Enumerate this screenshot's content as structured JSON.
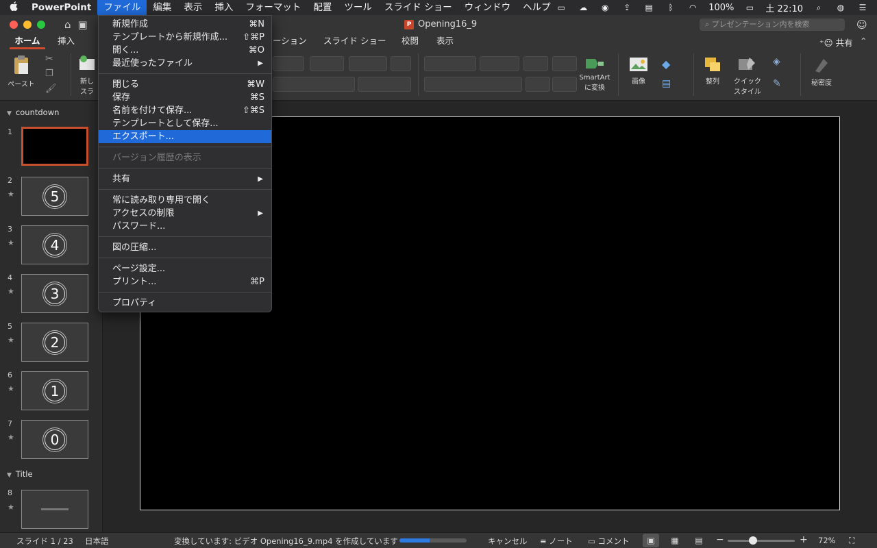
{
  "menubar": {
    "apple": "",
    "app": "PowerPoint",
    "items": [
      "ファイル",
      "編集",
      "表示",
      "挿入",
      "フォーマット",
      "配置",
      "ツール",
      "スライド ショー",
      "ウィンドウ",
      "ヘルプ"
    ],
    "battery": "100%",
    "clock": "土 22:10"
  },
  "window": {
    "title": "Opening16_9",
    "search_placeholder": "プレゼンテーション内を検索"
  },
  "ribbon": {
    "tabs": [
      "ホーム",
      "挿入",
      "ーション",
      "スライド ショー",
      "校閲",
      "表示"
    ],
    "share": "共有",
    "paste": "ペースト",
    "new_slide_partial": "新し",
    "new_slide_partial2": "スラ",
    "smartart_line1": "SmartArt",
    "smartart_line2": "に変換",
    "image": "画像",
    "arrange": "整列",
    "quick_style_line1": "クイック",
    "quick_style_line2": "スタイル",
    "sensitivity": "秘密度"
  },
  "panel": {
    "sections": [
      "countdown",
      "Title"
    ],
    "slides": [
      {
        "num": "1",
        "label": ""
      },
      {
        "num": "2",
        "label": "5"
      },
      {
        "num": "3",
        "label": "4"
      },
      {
        "num": "4",
        "label": "3"
      },
      {
        "num": "5",
        "label": "2"
      },
      {
        "num": "6",
        "label": "1"
      },
      {
        "num": "7",
        "label": "0"
      },
      {
        "num": "8",
        "label": ""
      }
    ],
    "star": "★"
  },
  "file_menu": {
    "items": [
      {
        "label": "新規作成",
        "shortcut": "⌘N"
      },
      {
        "label": "テンプレートから新規作成...",
        "shortcut": "⇧⌘P"
      },
      {
        "label": "開く...",
        "shortcut": "⌘O"
      },
      {
        "label": "最近使ったファイル",
        "shortcut": "▶"
      },
      {
        "label": "閉じる",
        "shortcut": "⌘W"
      },
      {
        "label": "保存",
        "shortcut": "⌘S"
      },
      {
        "label": "名前を付けて保存...",
        "shortcut": "⇧⌘S"
      },
      {
        "label": "テンプレートとして保存...",
        "shortcut": ""
      },
      {
        "label": "エクスポート...",
        "shortcut": ""
      },
      {
        "label": "バージョン履歴の表示",
        "shortcut": ""
      },
      {
        "label": "共有",
        "shortcut": "▶"
      },
      {
        "label": "常に読み取り専用で開く",
        "shortcut": ""
      },
      {
        "label": "アクセスの制限",
        "shortcut": "▶"
      },
      {
        "label": "パスワード...",
        "shortcut": ""
      },
      {
        "label": "図の圧縮...",
        "shortcut": ""
      },
      {
        "label": "ページ設定...",
        "shortcut": ""
      },
      {
        "label": "プリント...",
        "shortcut": "⌘P"
      },
      {
        "label": "プロパティ",
        "shortcut": ""
      }
    ]
  },
  "status": {
    "slide_count": "スライド 1 / 23",
    "language": "日本語",
    "progress_text": "変換しています: ビデオ Opening16_9.mp4  を作成しています",
    "progress": 0.45,
    "cancel": "キャンセル",
    "notes": "ノート",
    "comments": "コメント",
    "zoom": "72%"
  },
  "colors": {
    "accent": "#1f6ad8",
    "selected_slide_border": "#c9502f",
    "home_tab_underline": "#d04a2c"
  }
}
